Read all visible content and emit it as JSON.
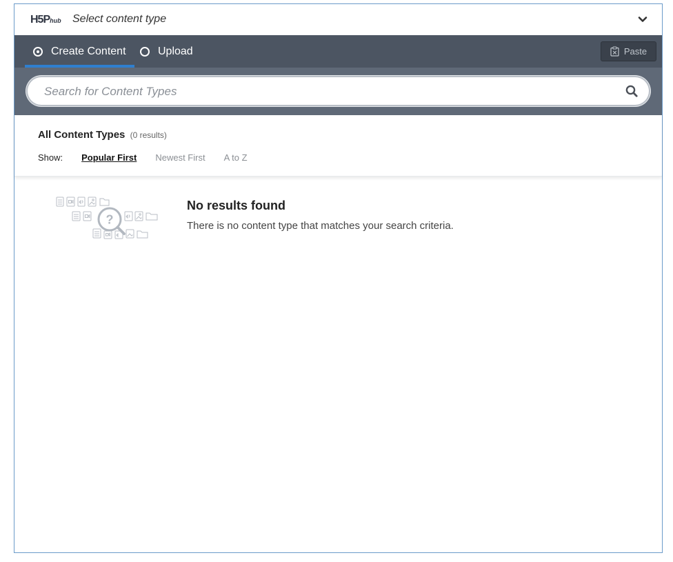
{
  "header": {
    "logo_main": "H5P",
    "logo_sub": "hub",
    "title": "Select content type",
    "toggle_icon": "chevron-down-icon"
  },
  "tabs": [
    {
      "label": "Create Content",
      "selected": true
    },
    {
      "label": "Upload",
      "selected": false
    }
  ],
  "paste_button": {
    "label": "Paste",
    "icon": "clipboard-icon"
  },
  "search": {
    "placeholder": "Search for Content Types",
    "value": "",
    "icon": "search-icon"
  },
  "results": {
    "title": "All Content Types",
    "count_text": "(0 results)",
    "show_label": "Show:",
    "sort_options": [
      {
        "label": "Popular First",
        "active": true
      },
      {
        "label": "Newest First",
        "active": false
      },
      {
        "label": "A to Z",
        "active": false
      }
    ]
  },
  "empty_state": {
    "title": "No results found",
    "description": "There is no content type that matches your search criteria.",
    "illustration": "magnifier-question-icon"
  },
  "colors": {
    "tab_bar": "#4c5562",
    "search_band": "#5f6977",
    "active_tab_underline": "#2f7fcf",
    "border": "#6a9ac9"
  }
}
